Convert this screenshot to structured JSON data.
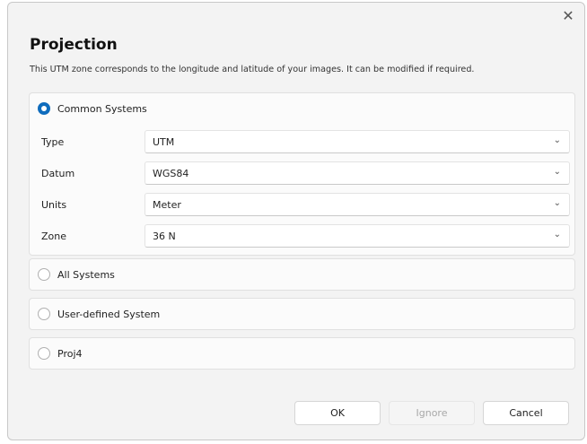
{
  "dialog": {
    "close_glyph": "✕",
    "title": "Projection",
    "description": "This UTM zone corresponds to the longitude and latitude of your images. It can be modified if required."
  },
  "common_systems": {
    "label": "Common Systems",
    "selected": true,
    "fields": [
      {
        "label": "Type",
        "value": "UTM"
      },
      {
        "label": "Datum",
        "value": "WGS84"
      },
      {
        "label": "Units",
        "value": "Meter"
      },
      {
        "label": "Zone",
        "value": "36 N"
      }
    ],
    "chevron_glyph": "⌄"
  },
  "other_systems": [
    {
      "label": "All Systems",
      "selected": false
    },
    {
      "label": "User-defined System",
      "selected": false
    },
    {
      "label": "Proj4",
      "selected": false
    }
  ],
  "buttons": {
    "ok": "OK",
    "ignore": "Ignore",
    "cancel": "Cancel"
  },
  "colors": {
    "accent": "#0f6cbd",
    "dialog_bg": "#f3f3f3",
    "disabled_text": "#a8a8a8"
  }
}
